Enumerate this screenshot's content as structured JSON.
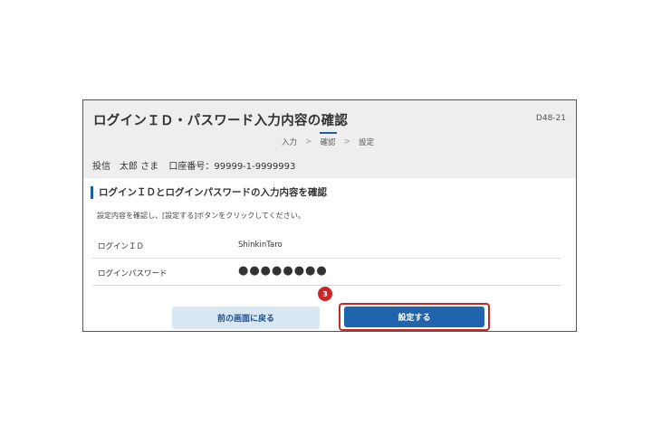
{
  "header": {
    "title": "ログインＩＤ・パスワード入力内容の確認",
    "screen_id": "D48-21",
    "steps": [
      "入力",
      "確認",
      "設定"
    ],
    "active_step": 1,
    "user_name": "投信　太郎 さま",
    "account_label": "口座番号：",
    "account_number": "99999-1-9999993"
  },
  "section": {
    "title": "ログインＩＤとログインパスワードの入力内容を確認",
    "instruction": "設定内容を確認し、[設定する]ボタンをクリックしてください。"
  },
  "rows": [
    {
      "label": "ログインＩＤ",
      "value": "ShinkinTaro"
    },
    {
      "label": "ログインパスワード",
      "value": "●●●●●●●●"
    }
  ],
  "buttons": {
    "back": "前の画面に戻る",
    "submit": "設定する"
  },
  "annotation": {
    "marker": "3"
  },
  "colors": {
    "accent": "#1f64ad",
    "highlight": "#c62828",
    "header_bg": "#eeeeee"
  }
}
